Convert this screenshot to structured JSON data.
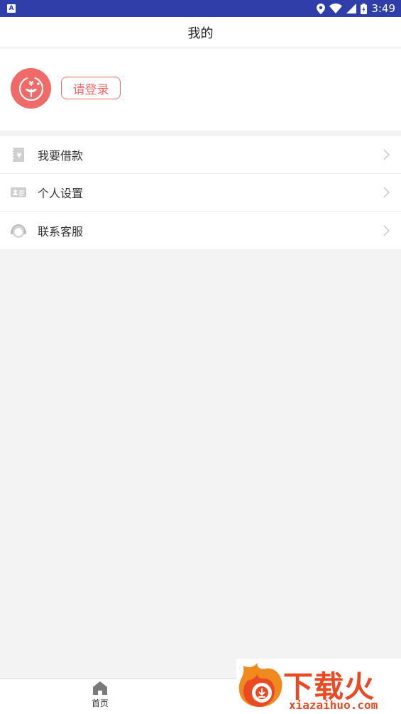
{
  "status_bar": {
    "time": "3:49"
  },
  "header": {
    "title": "我的"
  },
  "profile": {
    "login_label": "请登录"
  },
  "menu": {
    "items": [
      {
        "label": "我要借款",
        "icon": "loan-note-icon"
      },
      {
        "label": "个人设置",
        "icon": "id-card-icon"
      },
      {
        "label": "联系客服",
        "icon": "headset-icon"
      }
    ]
  },
  "tabbar": {
    "home_label": "首页"
  },
  "watermark": {
    "brand": "下载火",
    "url": "xiazaihuo.com"
  },
  "colors": {
    "accent": "#f06a68",
    "status_bar": "#2f3ea8",
    "watermark": "#e94a23"
  }
}
